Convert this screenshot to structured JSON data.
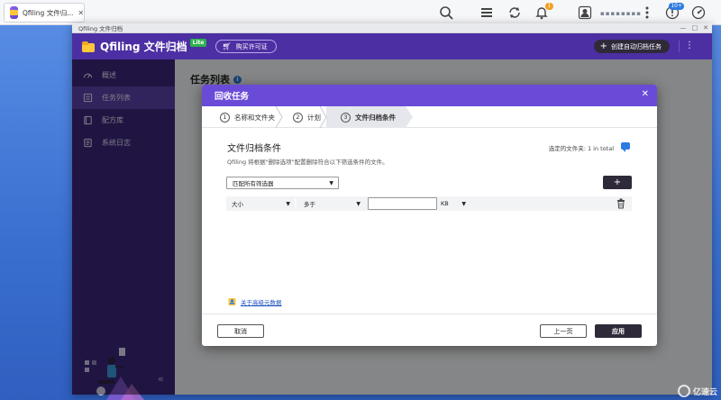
{
  "taskbar": {
    "tab_title": "Qfiling 文件归...",
    "close": "✕",
    "notification_badge": "1",
    "download_badge": "10+"
  },
  "window": {
    "title": "Qfiling 文件归档",
    "controls": {
      "minimize": "—",
      "maximize": "□",
      "close": "✕"
    }
  },
  "app": {
    "name": "Qfiling 文件归档",
    "edition": "Lite",
    "buy_license": "购买许可证",
    "create_auto_task": "创建自动归档任务"
  },
  "sidebar": {
    "items": [
      {
        "label": "概述",
        "icon": "speedometer-icon",
        "active": false
      },
      {
        "label": "任务列表",
        "icon": "list-icon",
        "active": true
      },
      {
        "label": "配方库",
        "icon": "book-icon",
        "active": false
      },
      {
        "label": "系统日志",
        "icon": "log-icon",
        "active": false
      }
    ],
    "collapse": "«"
  },
  "content": {
    "title": "任务列表",
    "info": "i"
  },
  "modal": {
    "title": "回收任务",
    "close": "✕",
    "steps": [
      {
        "num": "1",
        "label": "名称和文件夹"
      },
      {
        "num": "2",
        "label": "计划"
      },
      {
        "num": "3",
        "label": "文件归档条件"
      }
    ],
    "section_title": "文件归档条件",
    "description": "Qfiling 将根据\"删除选项\"配置删除符合以下筛选条件的文件。",
    "selected_files": "选定的文件夹: 1 in total",
    "match_select": "匹配所有筛选器",
    "add_button": "+",
    "filter": {
      "field": "大小",
      "operator": "多于",
      "value": "",
      "unit": "KB"
    },
    "metadata_link": "关于高级元数据",
    "buttons": {
      "cancel": "取消",
      "previous": "上一页",
      "apply": "应用"
    }
  },
  "colors": {
    "accent": "#6a4bd8",
    "sidebar": "#3b2779",
    "header": "#4c2fa3",
    "dark_button": "#2f2a3a"
  },
  "watermark": "亿速云"
}
